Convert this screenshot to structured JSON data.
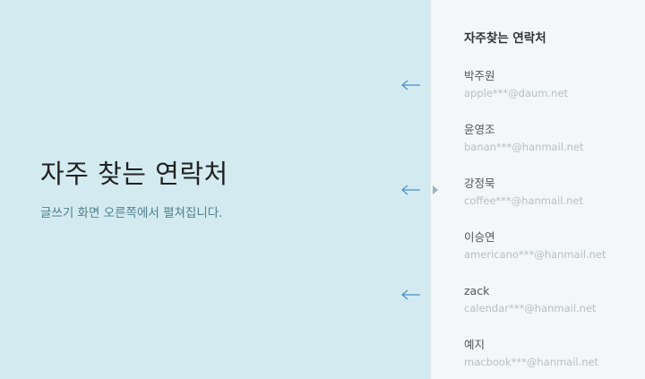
{
  "hero": {
    "title": "자주 찾는 연락처",
    "subtitle": "글쓰기 화면 오른쪽에서 펼쳐집니다."
  },
  "panel": {
    "title": "자주찾는 연락처",
    "contacts": [
      {
        "name": "박주원",
        "email": "apple***@daum.net"
      },
      {
        "name": "윤영조",
        "email": "banan***@hanmail.net"
      },
      {
        "name": "강정묵",
        "email": "coffee***@hanmail.net"
      },
      {
        "name": "이승연",
        "email": "americano***@hanmail.net"
      },
      {
        "name": "zack",
        "email": "calendar***@hanmail.net"
      },
      {
        "name": "예지",
        "email": "macbook***@hanmail.net"
      }
    ]
  },
  "icons": {
    "arrow": "arrow-left-icon",
    "pointer": "caret-right-icon"
  },
  "colors": {
    "left_background": "#d3ebf0",
    "right_background": "#f3f7f8",
    "arrow": "#4a90c8",
    "subtitle": "#4f7f8b"
  }
}
